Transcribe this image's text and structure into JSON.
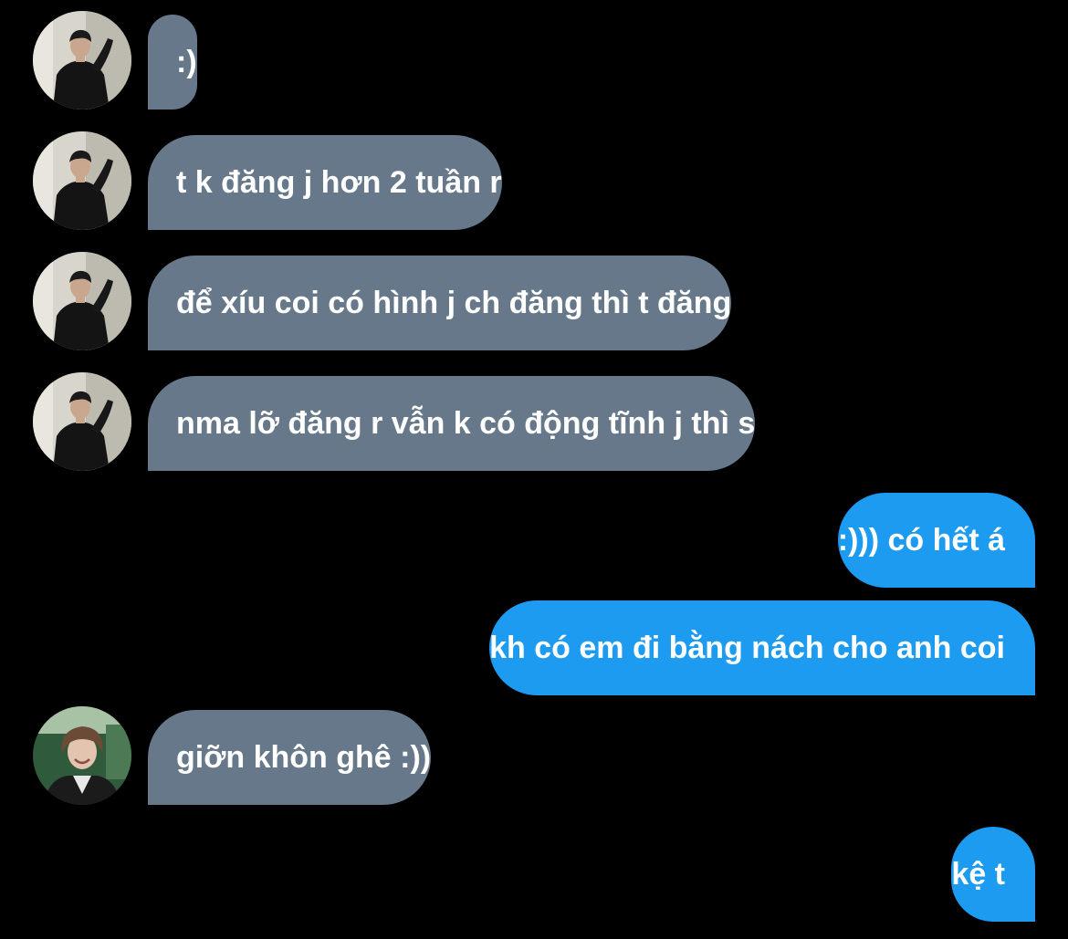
{
  "colors": {
    "background": "#000000",
    "incoming_bubble": "#66788a",
    "outgoing_bubble": "#1d9bf0",
    "text": "#ffffff"
  },
  "messages": [
    {
      "side": "incoming",
      "text": ":)",
      "avatar": "user-a-avatar"
    },
    {
      "side": "incoming",
      "text": "t k đăng j hơn 2 tuần r",
      "avatar": "user-a-avatar"
    },
    {
      "side": "incoming",
      "text": "để xíu coi có hình j ch đăng thì t đăng",
      "avatar": "user-a-avatar"
    },
    {
      "side": "incoming",
      "text": "nma lỡ đăng r vẫn k có động tĩnh j thì s",
      "avatar": "user-a-avatar"
    },
    {
      "side": "outgoing",
      "text": ":))) có hết á"
    },
    {
      "side": "outgoing",
      "text": "kh có em đi bằng nách cho anh coi"
    },
    {
      "side": "incoming",
      "text": "giỡn khôn ghê :))",
      "avatar": "user-b-avatar"
    },
    {
      "side": "outgoing",
      "text": "kệ t"
    }
  ]
}
